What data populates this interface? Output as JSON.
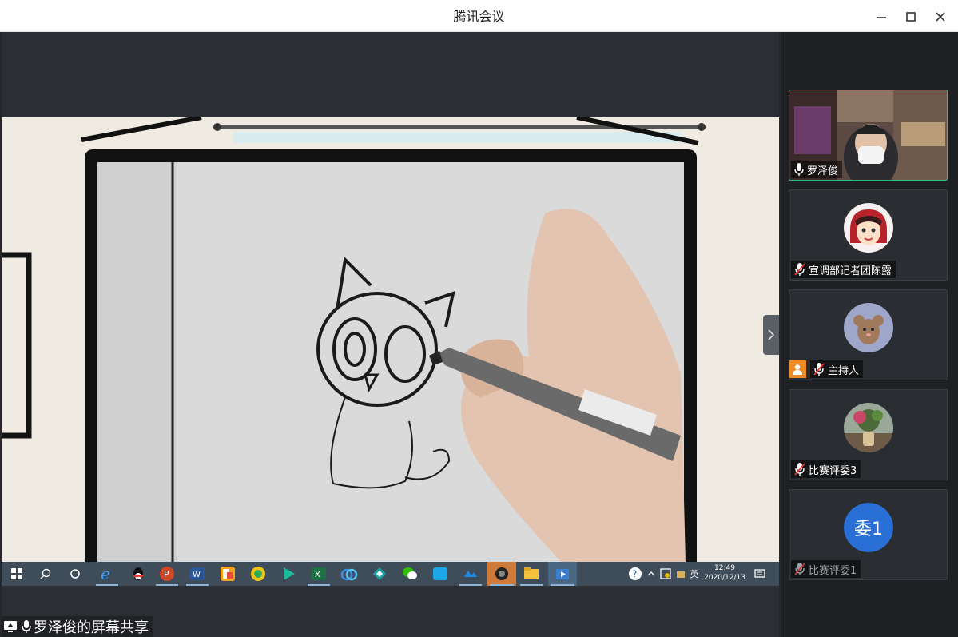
{
  "window": {
    "title": "腾讯会议",
    "controls": [
      "minimize",
      "maximize",
      "close"
    ]
  },
  "share": {
    "label": "罗泽俊的屏幕共享",
    "taskbar": {
      "time": "12:49",
      "date": "2020/12/13",
      "ime": "英",
      "apps": [
        "windows-start-icon",
        "search-icon",
        "cortana-icon",
        "ie-icon",
        "qq-icon",
        "powerpoint-icon",
        "word-icon",
        "wps-icon",
        "green-app-icon",
        "video-player-icon",
        "excel-icon",
        "baidu-netdisk-icon",
        "boat-app-icon",
        "wechat-icon",
        "zoom-app-icon",
        "tencent-meeting-icon",
        "camera-icon",
        "file-explorer-icon",
        "media-app-icon"
      ]
    }
  },
  "participants": [
    {
      "name": "罗泽俊",
      "mic": "on",
      "type": "video"
    },
    {
      "name": "宣调部记者团陈露",
      "mic": "muted",
      "type": "avatar"
    },
    {
      "name": "主持人",
      "mic": "muted",
      "type": "avatar",
      "host": true
    },
    {
      "name": "比赛评委3",
      "mic": "muted",
      "type": "avatar"
    },
    {
      "name": "比赛评委1",
      "mic": "muted",
      "type": "text-avatar",
      "avatar_text": "委1"
    }
  ],
  "colors": {
    "accent": "#2ec27e",
    "host_badge": "#f08a24",
    "text_avatar": "#2a6fd6"
  }
}
